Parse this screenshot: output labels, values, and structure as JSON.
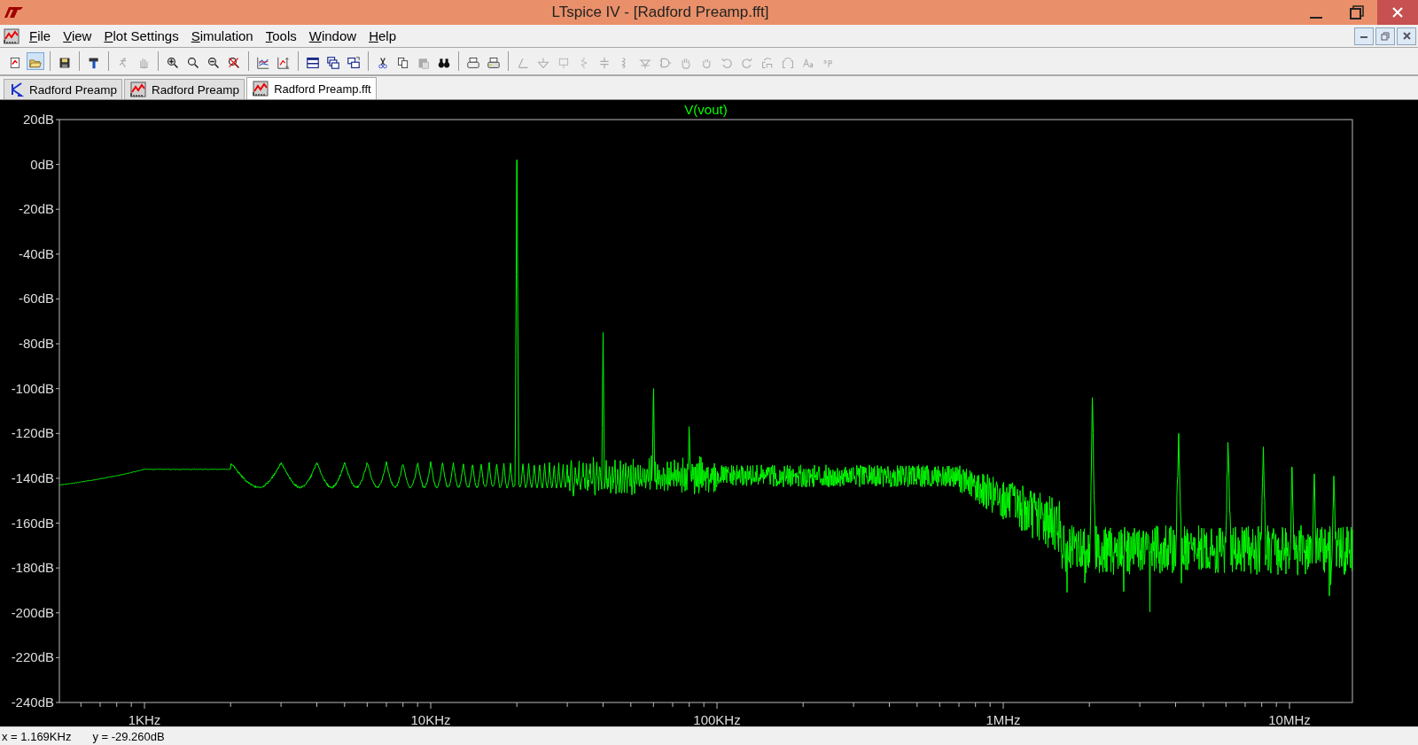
{
  "window": {
    "title": "LTspice IV - [Radford Preamp.fft]"
  },
  "menu": [
    "File",
    "View",
    "Plot Settings",
    "Simulation",
    "Tools",
    "Window",
    "Help"
  ],
  "tabs": [
    {
      "label": "Radford Preamp",
      "kind": "schematic",
      "selected": false
    },
    {
      "label": "Radford Preamp",
      "kind": "waveform",
      "selected": false
    },
    {
      "label": "Radford Preamp.fft",
      "kind": "waveform",
      "selected": true
    }
  ],
  "plot": {
    "trace_name": "V(vout)",
    "y_ticks": [
      "20dB",
      "0dB",
      "-20dB",
      "-40dB",
      "-60dB",
      "-80dB",
      "-100dB",
      "-120dB",
      "-140dB",
      "-160dB",
      "-180dB",
      "-200dB",
      "-220dB",
      "-240dB"
    ],
    "x_ticks": [
      "1KHz",
      "10KHz",
      "100KHz",
      "1MHz",
      "10MHz"
    ]
  },
  "status_bar": {
    "x_reading": "x = 1.169KHz",
    "y_reading": "y = -29.260dB"
  }
}
